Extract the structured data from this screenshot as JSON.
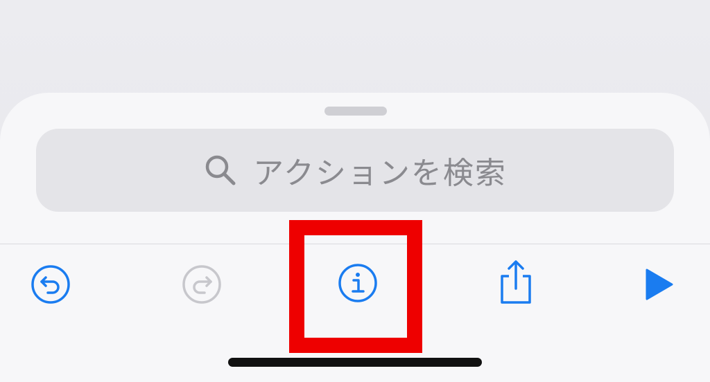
{
  "search": {
    "placeholder": "アクションを検索",
    "icon": "magnifying-glass"
  },
  "toolbar": {
    "items": [
      {
        "id": "undo",
        "icon": "undo-arrow-circle",
        "enabled": true
      },
      {
        "id": "redo",
        "icon": "redo-arrow-circle",
        "enabled": false
      },
      {
        "id": "info",
        "icon": "info-circle",
        "enabled": true,
        "highlighted": true
      },
      {
        "id": "share",
        "icon": "share-box-arrow",
        "enabled": true
      },
      {
        "id": "run",
        "icon": "play-triangle",
        "enabled": true
      }
    ]
  },
  "colors": {
    "accent": "#1a7cf0",
    "disabled": "#c7c7cc",
    "highlight": "#ee0000",
    "placeholder": "#8a8a8f"
  }
}
